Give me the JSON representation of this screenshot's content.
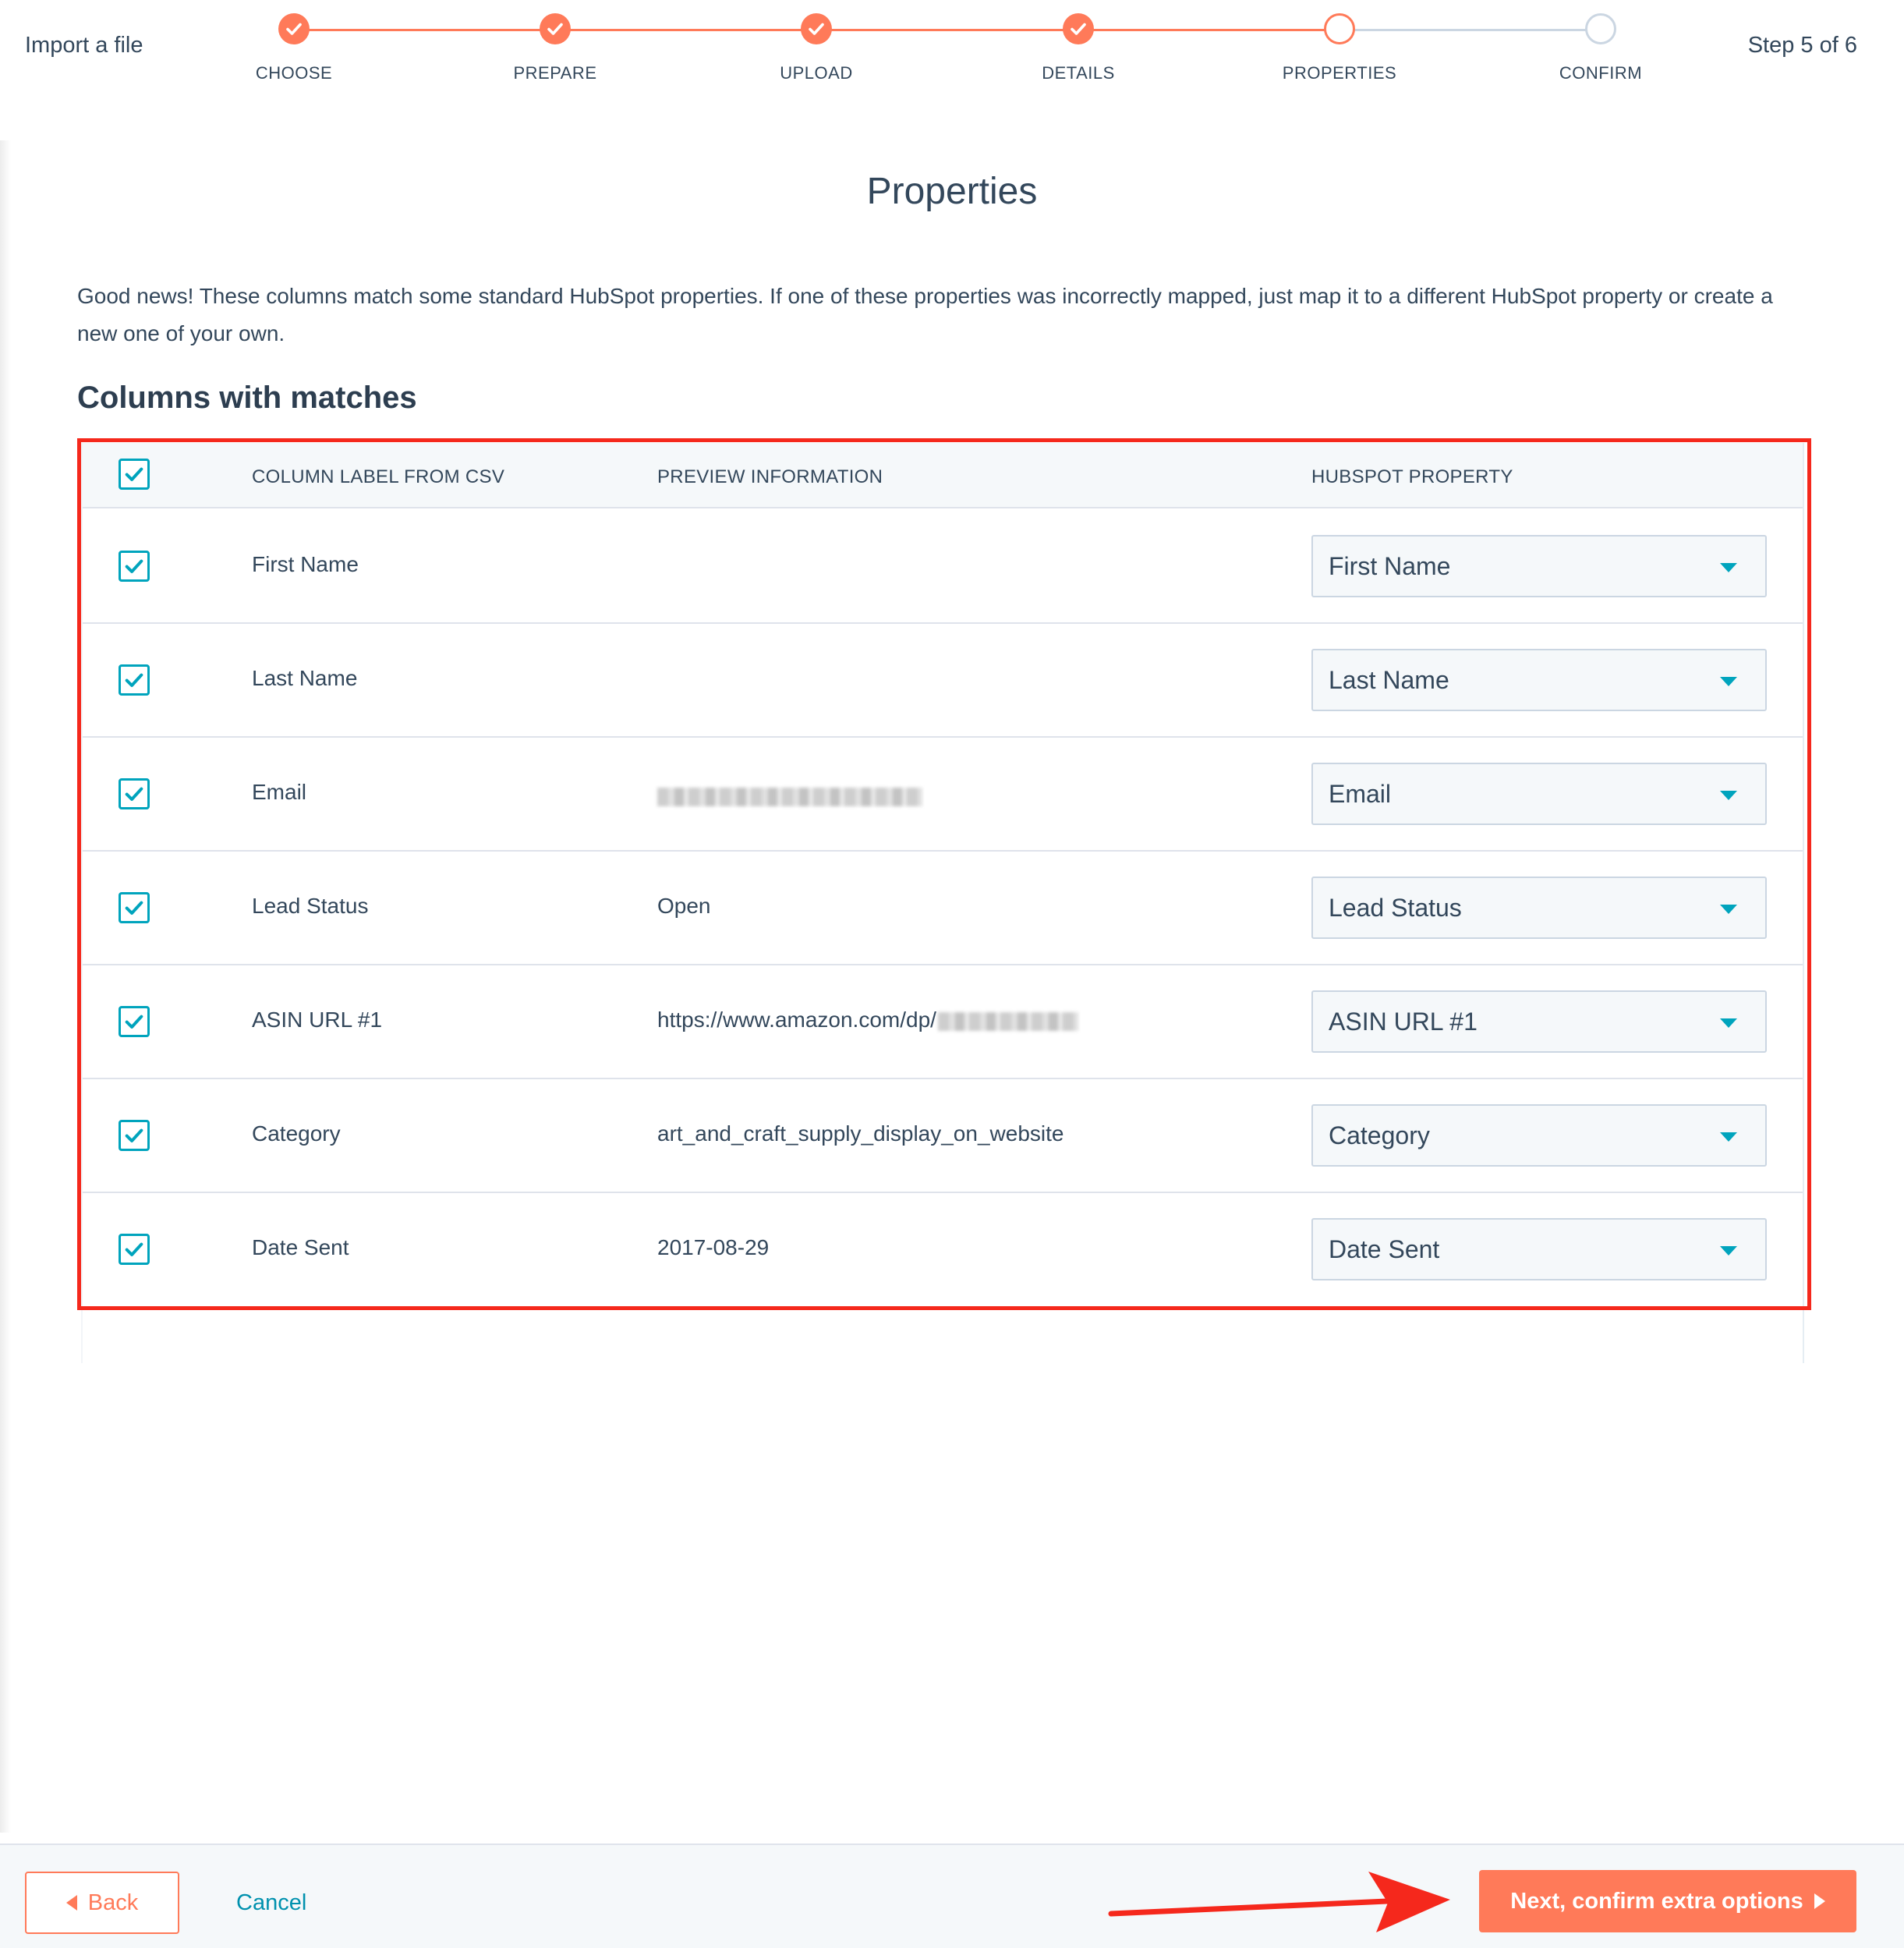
{
  "header": {
    "title": "Import a file",
    "step_count": "Step 5 of 6"
  },
  "stepper": {
    "steps": [
      {
        "label": "CHOOSE",
        "state": "done"
      },
      {
        "label": "PREPARE",
        "state": "done"
      },
      {
        "label": "UPLOAD",
        "state": "done"
      },
      {
        "label": "DETAILS",
        "state": "done"
      },
      {
        "label": "PROPERTIES",
        "state": "active"
      },
      {
        "label": "CONFIRM",
        "state": "todo"
      }
    ]
  },
  "main": {
    "title": "Properties",
    "intro": "Good news! These columns match some standard HubSpot properties. If one of these properties was incorrectly mapped, just map it to a different HubSpot property or create a new one of your own.",
    "section_title": "Columns with matches"
  },
  "table": {
    "headers": {
      "label": "COLUMN LABEL FROM CSV",
      "preview": "PREVIEW INFORMATION",
      "property": "HUBSPOT PROPERTY"
    },
    "all_checked": true,
    "rows": [
      {
        "label": "First Name",
        "preview": "",
        "preview_redacted": false,
        "property": "First Name",
        "checked": true
      },
      {
        "label": "Last Name",
        "preview": "",
        "preview_redacted": false,
        "property": "Last Name",
        "checked": true
      },
      {
        "label": "Email",
        "preview": "",
        "preview_redacted": true,
        "property": "Email",
        "checked": true
      },
      {
        "label": "Lead Status",
        "preview": "Open",
        "preview_redacted": false,
        "property": "Lead Status",
        "checked": true
      },
      {
        "label": "ASIN URL #1",
        "preview": "https://www.amazon.com/dp/",
        "preview_redacted": true,
        "property": "ASIN URL #1",
        "checked": true
      },
      {
        "label": "Category",
        "preview": "art_and_craft_supply_display_on_website",
        "preview_redacted": false,
        "property": "Category",
        "checked": true
      },
      {
        "label": "Date Sent",
        "preview": "2017-08-29",
        "preview_redacted": false,
        "property": "Date Sent",
        "checked": true
      }
    ]
  },
  "footer": {
    "back_label": "Back",
    "cancel_label": "Cancel",
    "next_label": "Next, confirm extra options"
  },
  "colors": {
    "accent": "#ff7a59",
    "checkbox": "#00a4bd",
    "link": "#0091ae",
    "text": "#33475b",
    "annotation": "#f5281c"
  },
  "icons": {
    "step_done": "check-icon",
    "checkbox": "checkbox-checked-icon",
    "select": "caret-down-icon",
    "back": "triangle-left-icon",
    "next": "triangle-right-icon"
  }
}
